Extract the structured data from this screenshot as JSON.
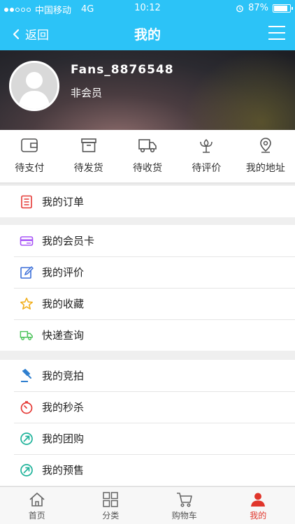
{
  "status_bar": {
    "carrier": "中国移动",
    "network": "4G",
    "time": "10:12",
    "battery": "87%",
    "battery_level": 0.87
  },
  "nav": {
    "back_label": "返回",
    "title": "我的"
  },
  "profile": {
    "username": "Fans_8876548",
    "member_status": "非会员"
  },
  "order_shortcuts": [
    {
      "label": "待支付",
      "icon": "wallet-icon"
    },
    {
      "label": "待发货",
      "icon": "box-icon"
    },
    {
      "label": "待收货",
      "icon": "truck-icon"
    },
    {
      "label": "待评价",
      "icon": "flower-icon"
    },
    {
      "label": "我的地址",
      "icon": "location-pin-icon"
    }
  ],
  "menu": {
    "group1": [
      {
        "label": "我的订单",
        "icon": "order-list-icon",
        "color": "#e53935"
      }
    ],
    "group2": [
      {
        "label": "我的会员卡",
        "icon": "card-icon",
        "color": "#a855f7"
      },
      {
        "label": "我的评价",
        "icon": "edit-icon",
        "color": "#3b6fd8"
      },
      {
        "label": "我的收藏",
        "icon": "star-icon",
        "color": "#f2b01e"
      },
      {
        "label": "快递查询",
        "icon": "truck-icon",
        "color": "#4cc35a"
      }
    ],
    "group3": [
      {
        "label": "我的竞拍",
        "icon": "auction-icon",
        "color": "#2f7fcf"
      },
      {
        "label": "我的秒杀",
        "icon": "timer-icon",
        "color": "#e53935"
      },
      {
        "label": "我的团购",
        "icon": "arrow-circle-icon",
        "color": "#1fb39a"
      },
      {
        "label": "我的预售",
        "icon": "arrow-circle-icon",
        "color": "#1fb39a"
      }
    ]
  },
  "tabs": [
    {
      "label": "首页",
      "icon": "home-icon"
    },
    {
      "label": "分类",
      "icon": "grid-icon"
    },
    {
      "label": "购物车",
      "icon": "cart-icon"
    },
    {
      "label": "我的",
      "icon": "user-icon",
      "active": true
    }
  ],
  "colors": {
    "brand": "#2cc3f7",
    "active_tab": "#e0352b"
  }
}
